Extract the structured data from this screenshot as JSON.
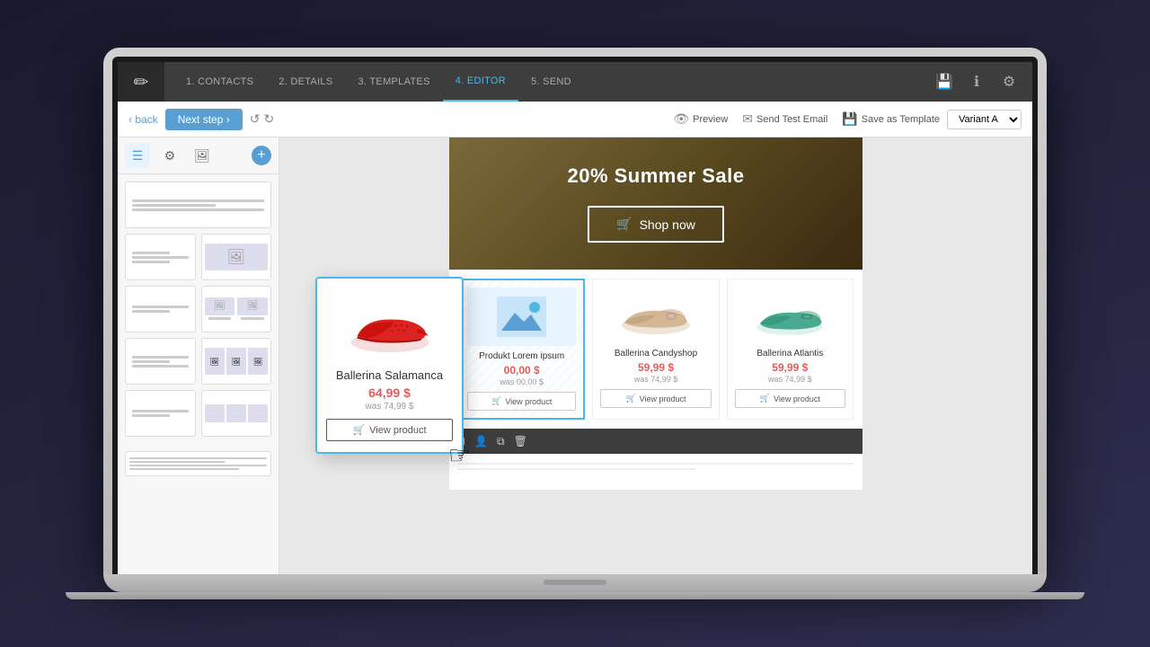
{
  "laptop": {
    "screen_bg": "#f0f0f0"
  },
  "app": {
    "logo": "✏",
    "nav_steps": [
      {
        "label": "1. CONTACTS",
        "active": false
      },
      {
        "label": "2. DETAILS",
        "active": false
      },
      {
        "label": "3. TEMPLATES",
        "active": false
      },
      {
        "label": "4. EDITOR",
        "active": true
      },
      {
        "label": "5. SEND",
        "active": false
      }
    ],
    "nav_icons": [
      "💾",
      "ℹ",
      "⚙"
    ],
    "toolbar": {
      "back_label": "‹ back",
      "next_label": "Next step ›",
      "undo_label": "↺",
      "redo_label": "↻",
      "preview_label": "Preview",
      "send_test_label": "Send Test Email",
      "save_template_label": "Save as Template",
      "variant_label": "Variant A"
    },
    "sidebar": {
      "tabs": [
        "☰",
        "⚙",
        "🖼"
      ],
      "add_label": "+"
    }
  },
  "email": {
    "hero": {
      "title": "20% Summer Sale",
      "button_label": "Shop now",
      "cart_icon": "🛒"
    },
    "products": [
      {
        "id": "placeholder",
        "name": "Produkt Lorem ipsum",
        "price": "00,00 $",
        "was_price": "was 00,00 $",
        "btn_label": "View product",
        "is_placeholder": true
      },
      {
        "id": "candyshop",
        "name": "Ballerina Candyshop",
        "price": "59,99 $",
        "was_price": "was 74,99 $",
        "btn_label": "View product",
        "is_placeholder": false
      },
      {
        "id": "atlantis",
        "name": "Ballerina Atlantis",
        "price": "59,99 $",
        "was_price": "was 74,99 $",
        "btn_label": "View product",
        "is_placeholder": false
      }
    ],
    "floating_card": {
      "name": "Ballerina Salamanca",
      "price": "64,99 $",
      "was_price": "was 74,99 $",
      "btn_label": "View product",
      "cart_icon": "🛒"
    }
  }
}
